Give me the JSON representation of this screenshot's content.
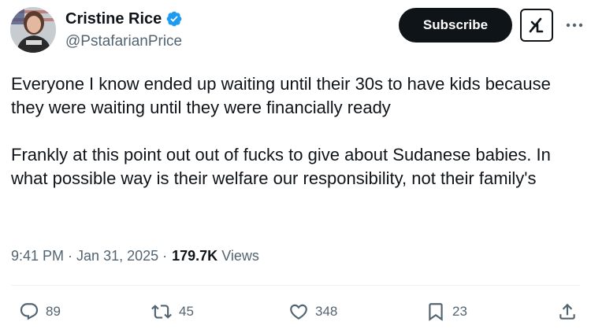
{
  "author": {
    "display_name": "Cristine Rice",
    "handle": "@PstafarianPrice",
    "verified": true
  },
  "header": {
    "subscribe_label": "Subscribe",
    "grok_icon": "grok-icon",
    "more_icon": "more-icon"
  },
  "tweet": {
    "paragraphs": [
      "Everyone I know ended up waiting until their 30s to have kids because they were waiting until they were financially ready",
      "Frankly at this point out out of fucks to give about Sudanese babies. In what possible way is their welfare our responsibility, not their family's"
    ]
  },
  "meta": {
    "time": "9:41 PM",
    "separator": "·",
    "date": "Jan 31, 2025",
    "views_count": "179.7K",
    "views_label": "Views"
  },
  "actions": {
    "replies": "89",
    "reposts": "45",
    "likes": "348",
    "bookmarks": "23"
  },
  "colors": {
    "text": "#0f1419",
    "secondary": "#536471",
    "verified": "#1d9bf0",
    "button": "#0f1419"
  }
}
